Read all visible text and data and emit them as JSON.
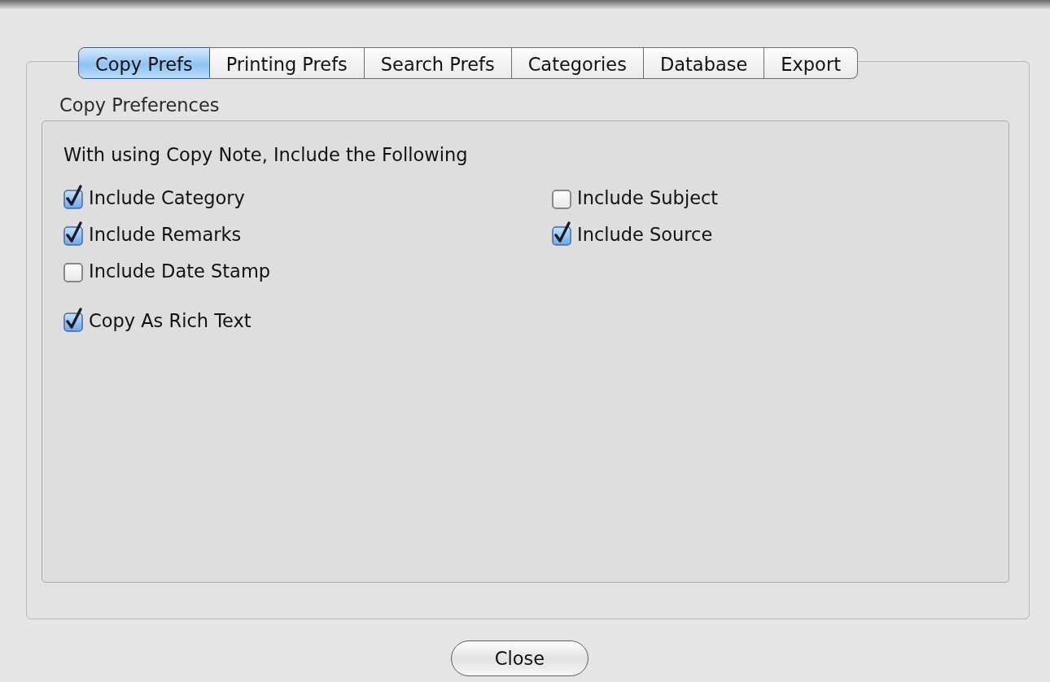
{
  "tabs": [
    {
      "label": "Copy Prefs",
      "selected": true
    },
    {
      "label": "Printing Prefs",
      "selected": false
    },
    {
      "label": "Search Prefs",
      "selected": false
    },
    {
      "label": "Categories",
      "selected": false
    },
    {
      "label": "Database",
      "selected": false
    },
    {
      "label": "Export",
      "selected": false
    }
  ],
  "section_title": "Copy Preferences",
  "heading": "With using Copy Note, Include the Following",
  "option_groups": [
    {
      "rows": [
        {
          "items": [
            {
              "label": "Include Category",
              "checked": true
            },
            {
              "label": "Include Subject",
              "checked": false
            }
          ]
        },
        {
          "items": [
            {
              "label": "Include Remarks",
              "checked": true
            },
            {
              "label": "Include Source",
              "checked": true
            }
          ]
        },
        {
          "items": [
            {
              "label": "Include Date Stamp",
              "checked": false
            }
          ]
        }
      ]
    },
    {
      "rows": [
        {
          "items": [
            {
              "label": "Copy As Rich Text",
              "checked": true
            }
          ]
        }
      ]
    }
  ],
  "close_button": "Close"
}
